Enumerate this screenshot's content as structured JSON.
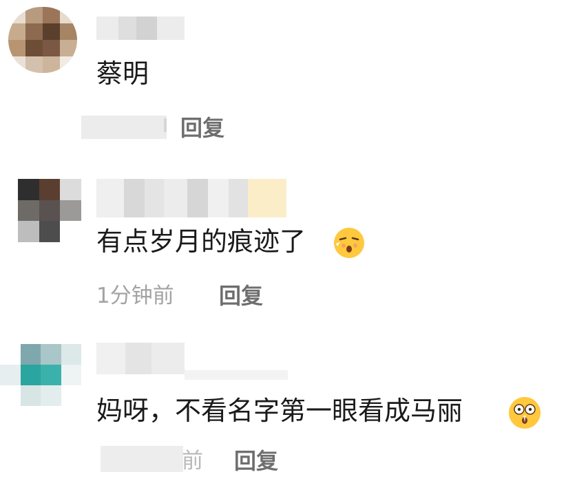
{
  "comments": [
    {
      "text": "蔡明",
      "time": "",
      "reply_label": "回复",
      "emoji": ""
    },
    {
      "text": "有点岁月的痕迹了",
      "time": "1分钟前",
      "reply_label": "回复",
      "emoji": "tongue-kiss-face"
    },
    {
      "text": "妈呀，不看名字第一眼看成马丽",
      "time": "前",
      "reply_label": "回复",
      "emoji": "shocked-face"
    }
  ],
  "colors": {
    "text": "#1a1a1a",
    "meta": "#a3a3a3",
    "reply": "#6e6e6e",
    "emoji_face": "#ffc83d"
  }
}
